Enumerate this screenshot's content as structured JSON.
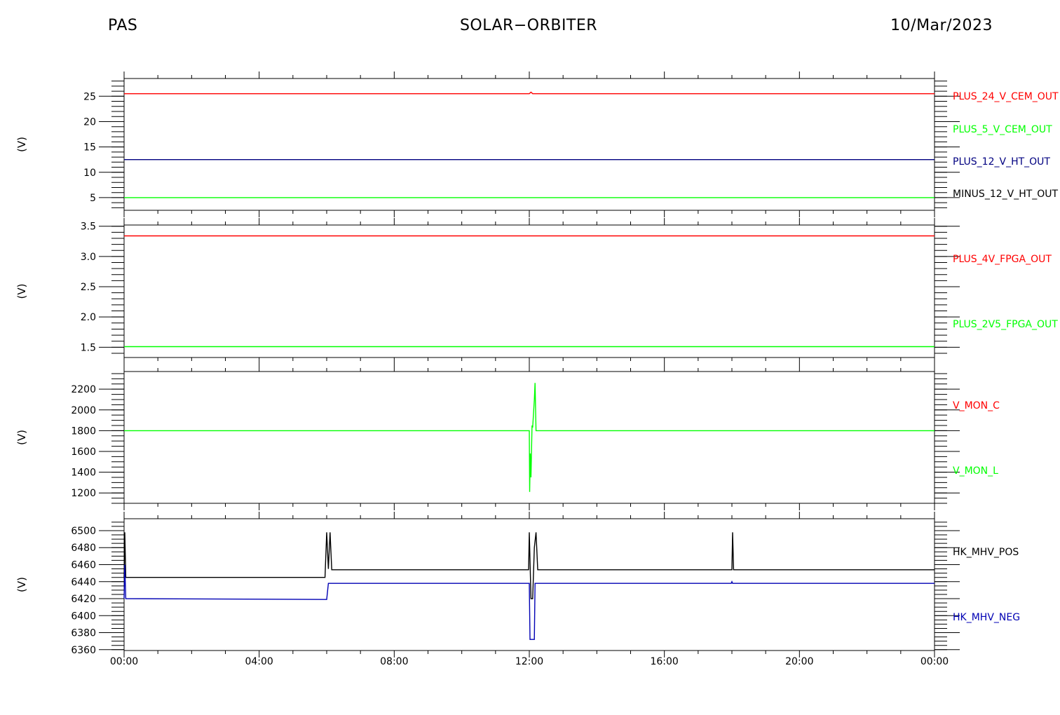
{
  "header": {
    "left": "PAS",
    "center": "SOLAR−ORBITER",
    "right": "10/Mar/2023"
  },
  "chart_data": [
    {
      "type": "line",
      "panel": 1,
      "ylabel": "(V)",
      "ylim": [
        2.5,
        28.5
      ],
      "yticks": [
        5,
        10,
        15,
        20,
        25
      ],
      "minor_step": 1,
      "series": [
        {
          "name": "PLUS_24_V_CEM_OUT",
          "color": "#ff0000",
          "points": [
            [
              0,
              25.5
            ],
            [
              12,
              25.5
            ],
            [
              12.05,
              25.8
            ],
            [
              12.1,
              25.5
            ],
            [
              24,
              25.5
            ]
          ]
        },
        {
          "name": "PLUS_5_V_CEM_OUT",
          "color": "#00ff00",
          "points": [
            [
              0,
              5
            ],
            [
              24,
              5
            ]
          ]
        },
        {
          "name": "PLUS_12_V_HT_OUT",
          "color": "#000080",
          "points": [
            [
              0,
              12.5
            ],
            [
              24,
              12.5
            ]
          ]
        },
        {
          "name": "MINUS_12_V_HT_OUT",
          "color": "#000000",
          "points": []
        }
      ]
    },
    {
      "type": "line",
      "panel": 2,
      "ylabel": "(V)",
      "ylim": [
        1.33,
        3.52
      ],
      "yticks": [
        1.5,
        2.0,
        2.5,
        3.0,
        3.5
      ],
      "minor_step": 0.1,
      "series": [
        {
          "name": "PLUS_4V_FPGA_OUT",
          "color": "#ff0000",
          "points": [
            [
              0,
              3.34
            ],
            [
              24,
              3.34
            ]
          ]
        },
        {
          "name": "PLUS_2V5_FPGA_OUT",
          "color": "#00ff00",
          "points": [
            [
              0,
              1.51
            ],
            [
              24,
              1.51
            ]
          ]
        }
      ]
    },
    {
      "type": "line",
      "panel": 3,
      "ylabel": "(V)",
      "ylim": [
        1100,
        2370
      ],
      "yticks": [
        1200,
        1400,
        1600,
        1800,
        2000,
        2200
      ],
      "minor_step": 50,
      "series": [
        {
          "name": "V_MON_C",
          "color": "#ff0000",
          "points": []
        },
        {
          "name": "V_MON_L",
          "color": "#00ff00",
          "points": [
            [
              0,
              1800
            ],
            [
              12.0,
              1800
            ],
            [
              12.01,
              1210
            ],
            [
              12.03,
              1580
            ],
            [
              12.05,
              1350
            ],
            [
              12.08,
              1850
            ],
            [
              12.1,
              1830
            ],
            [
              12.15,
              2100
            ],
            [
              12.17,
              2260
            ],
            [
              12.2,
              1800
            ],
            [
              24,
              1800
            ]
          ]
        }
      ]
    },
    {
      "type": "line",
      "panel": 4,
      "ylabel": "(V)",
      "ylim": [
        6359,
        6514
      ],
      "yticks": [
        6360,
        6380,
        6400,
        6420,
        6440,
        6460,
        6480,
        6500
      ],
      "minor_step": 5,
      "xlim": [
        0,
        24
      ],
      "xticks": [
        0,
        4,
        8,
        12,
        16,
        20,
        24
      ],
      "xticklabels": [
        "00:00",
        "04:00",
        "08:00",
        "12:00",
        "16:00",
        "20:00",
        "00:00"
      ],
      "series": [
        {
          "name": "HK_MHV_POS",
          "color": "#000000",
          "points": [
            [
              0,
              6445
            ],
            [
              0.02,
              6498
            ],
            [
              0.05,
              6445
            ],
            [
              5.95,
              6445
            ],
            [
              6.0,
              6498
            ],
            [
              6.05,
              6455
            ],
            [
              6.1,
              6498
            ],
            [
              6.15,
              6454
            ],
            [
              11.98,
              6454
            ],
            [
              12.0,
              6498
            ],
            [
              12.05,
              6420
            ],
            [
              12.1,
              6420
            ],
            [
              12.15,
              6480
            ],
            [
              12.2,
              6498
            ],
            [
              12.25,
              6454
            ],
            [
              18.0,
              6454
            ],
            [
              18.02,
              6498
            ],
            [
              18.05,
              6454
            ],
            [
              24,
              6454
            ]
          ]
        },
        {
          "name": "HK_MHV_NEG",
          "color": "#0000b4",
          "points": [
            [
              0,
              6420
            ],
            [
              0.02,
              6460
            ],
            [
              0.05,
              6420
            ],
            [
              5.95,
              6419
            ],
            [
              6.0,
              6419
            ],
            [
              6.05,
              6438
            ],
            [
              11.98,
              6438
            ],
            [
              12.0,
              6438
            ],
            [
              12.02,
              6372
            ],
            [
              12.15,
              6372
            ],
            [
              12.17,
              6438
            ],
            [
              17.98,
              6438
            ],
            [
              18.0,
              6440
            ],
            [
              18.02,
              6438
            ],
            [
              24,
              6438
            ]
          ]
        }
      ]
    }
  ]
}
